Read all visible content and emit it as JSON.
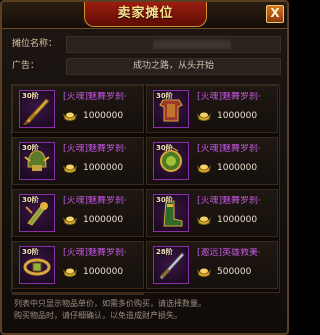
{
  "window": {
    "title": "卖家摊位",
    "close_glyph": "X"
  },
  "info": {
    "name_label": "摊位名称：",
    "name_value": "",
    "ad_label": "广告：",
    "ad_value": "成功之路，从头开始"
  },
  "items": [
    {
      "level": "30阶",
      "name": "[灭魂]魅舞罗刹·",
      "price": "1000000",
      "icon": "sword-icon",
      "frame": "#8a2fa8"
    },
    {
      "level": "30阶",
      "name": "[灭魂]魅舞罗刹·",
      "price": "1000000",
      "icon": "armor-icon",
      "frame": "#8a2fa8"
    },
    {
      "level": "30阶",
      "name": "[灭魂]魅舞罗刹·",
      "price": "1000000",
      "icon": "helmet-icon",
      "frame": "#8a2fa8"
    },
    {
      "level": "30阶",
      "name": "[灭魂]魅舞罗刹·",
      "price": "1000000",
      "icon": "necklace-icon",
      "frame": "#8a2fa8"
    },
    {
      "level": "30阶",
      "name": "[灭魂]魅舞罗刹·",
      "price": "1000000",
      "icon": "ring-icon",
      "frame": "#8a2fa8"
    },
    {
      "level": "30阶",
      "name": "[灭魂]魅舞罗刹·",
      "price": "1000000",
      "icon": "boots-icon",
      "frame": "#8a2fa8"
    },
    {
      "level": "30阶",
      "name": "[灭魂]魅舞罗刹·",
      "price": "1000000",
      "icon": "belt-icon",
      "frame": "#8a2fa8"
    },
    {
      "level": "28阶",
      "name": "[邀远]英雄救美·",
      "price": "500000",
      "icon": "weapon-icon",
      "frame": "#8a2fa8"
    }
  ],
  "note": {
    "line1": "列表中只显示物品单价，如需多价购买，请选择数量。",
    "line2": "购买物品时，请仔细确认，以免造成财产损失。"
  },
  "colors": {
    "accent": "#c456e0",
    "title": "#ffe08a",
    "frame": "#8a2fa8"
  }
}
